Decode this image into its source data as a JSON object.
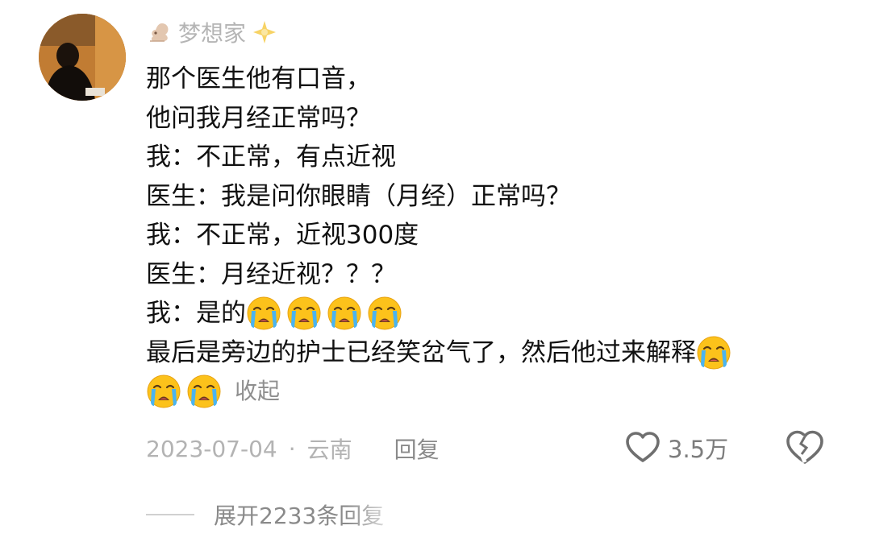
{
  "comment": {
    "username": "梦想家",
    "username_prefix_icon": "squirrel-icon",
    "username_suffix_icon": "sparkle-icon",
    "lines": [
      {
        "text": "那个医生他有口音，",
        "emoji_count": 0
      },
      {
        "text": "他问我月经正常吗？",
        "emoji_count": 0
      },
      {
        "text": "我：不正常，有点近视",
        "emoji_count": 0
      },
      {
        "text": "医生：我是问你眼睛（月经）正常吗？",
        "emoji_count": 0
      },
      {
        "text": "我：不正常，近视300度",
        "emoji_count": 0
      },
      {
        "text": "医生：月经近视？？？",
        "emoji_count": 0
      },
      {
        "text": "我：是的",
        "emoji_count": 4
      },
      {
        "text": "最后是旁边的护士已经笑岔气了，然后他过来解释",
        "emoji_count": 1
      }
    ],
    "trailing_emoji_count": 2,
    "emoji_icon": "loudly-crying-face-icon",
    "collapse_label": "收起",
    "date": "2023-07-04",
    "separator": "·",
    "location": "云南",
    "reply_label": "回复",
    "like_count": "3.5万",
    "expand_replies_label": "展开2233条回复"
  },
  "colors": {
    "text": "#111111",
    "meta": "#b3b3b3",
    "secondary": "#8a8a8a"
  }
}
